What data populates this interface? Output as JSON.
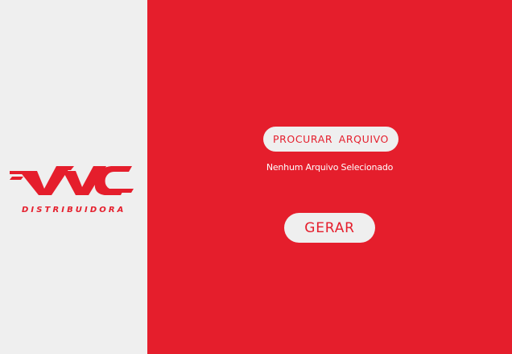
{
  "brand": {
    "logo_text": "VVC",
    "logo_subtitle": "DISTRIBUIDORA"
  },
  "upload": {
    "browse_label": "PROCURAR ARQUIVO",
    "status_text": "Nenhum Arquivo Selecionado"
  },
  "actions": {
    "generate_label": "GERAR"
  },
  "colors": {
    "brand_red": "#e51e2c",
    "panel_light": "#efefef"
  }
}
